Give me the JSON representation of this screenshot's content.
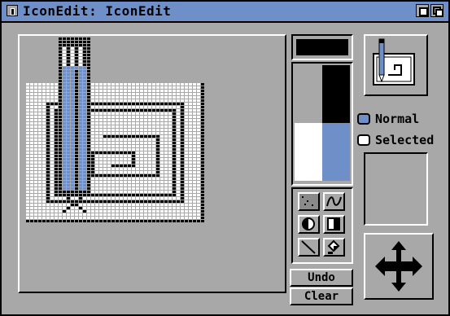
{
  "window": {
    "title": "IconEdit: IconEdit"
  },
  "colors": {
    "black": "#000000",
    "white": "#ffffff",
    "grey": "#a8a8a8",
    "blue": "#6f8fc8"
  },
  "palette": [
    {
      "name": "grey",
      "color": "#a8a8a8"
    },
    {
      "name": "black",
      "color": "#000000"
    },
    {
      "name": "white",
      "color": "#ffffff"
    },
    {
      "name": "blue",
      "color": "#6f8fc8"
    }
  ],
  "tools": [
    {
      "icon": "dot-icon"
    },
    {
      "icon": "freehand-icon"
    },
    {
      "icon": "circle-icon"
    },
    {
      "icon": "rectangle-icon"
    },
    {
      "icon": "line-icon"
    },
    {
      "icon": "fill-icon"
    }
  ],
  "buttons": {
    "undo": "Undo",
    "clear": "Clear"
  },
  "image_state": {
    "normal_label": "Normal",
    "selected_label": "Selected",
    "current": "Normal"
  }
}
